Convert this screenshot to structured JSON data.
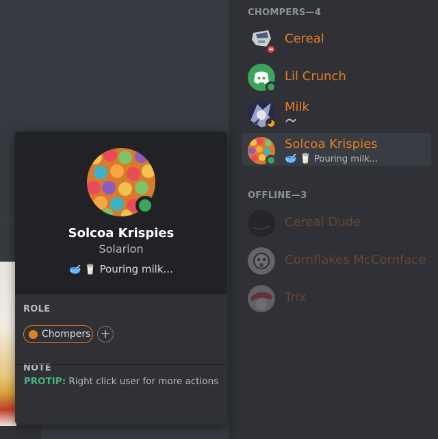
{
  "colors": {
    "role_orange": "#e67e22",
    "online_green": "#3ba55c",
    "protip_green": "#43b581"
  },
  "member_list": {
    "online_header": "CHOMPERS—4",
    "offline_header": "OFFLINE—3",
    "online": [
      {
        "name": "Cereal",
        "status": "dnd",
        "avatar_icon": "robot-head-icon"
      },
      {
        "name": "Lil Crunch",
        "status": "online",
        "avatar_icon": "discord-logo-icon"
      },
      {
        "name": "Milk",
        "status": "idle",
        "activity_icon": "pouring-icon",
        "avatar_icon": "anime-character-icon"
      },
      {
        "name": "Solcoa Krispies",
        "status": "online",
        "activity_emoji_1": "🥣",
        "activity_emoji_2": "🥛",
        "activity_text": "Pouring milk...",
        "avatar_icon": "cereal-icon"
      }
    ],
    "offline": [
      {
        "name": "Cereal Dude"
      },
      {
        "name": "Cornflakes McCornface"
      },
      {
        "name": "Trix"
      }
    ]
  },
  "popout": {
    "username": "Solcoa Krispies",
    "subtitle": "Solarion",
    "activity_emoji_1": "🥣",
    "activity_emoji_2": "🥛",
    "activity_text": "Pouring milk...",
    "role_label": "ROLE",
    "role_name": "Chompers",
    "add_role": "+",
    "note_label": "NOTE",
    "protip_key": "PROTIP:",
    "protip_text": "Right click user for more actions"
  }
}
